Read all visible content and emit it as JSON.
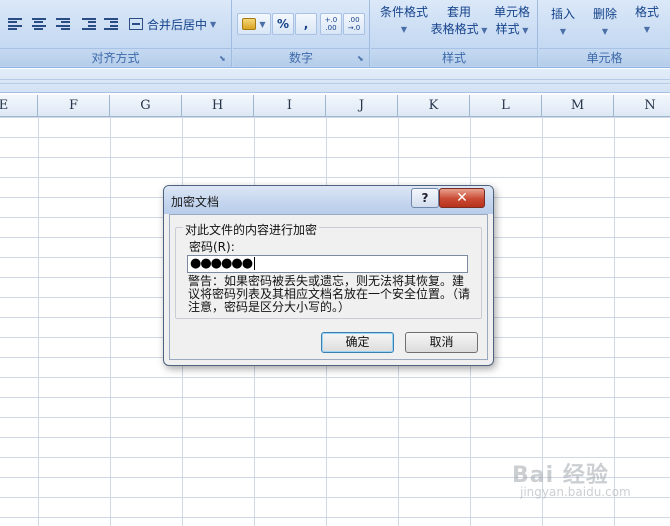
{
  "ribbon": {
    "alignment_group": {
      "merge_center_label": "合并后居中",
      "label": "对齐方式"
    },
    "number_group": {
      "percent_label": "%",
      "comma_label": ",",
      "increase_decimal_label": "+.0 .00",
      "decrease_decimal_label": ".00 →.0",
      "label": "数字"
    },
    "styles_group": {
      "conditional_format_label": "条件格式",
      "table_format_line1": "套用",
      "table_format_line2": "表格格式",
      "cell_style_line1": "单元格",
      "cell_style_line2": "样式",
      "label": "样式"
    },
    "cells_group": {
      "insert_label": "插入",
      "delete_label": "删除",
      "format_label": "格式",
      "label": "单元格"
    }
  },
  "columns": [
    "E",
    "F",
    "G",
    "H",
    "I",
    "J",
    "K",
    "L",
    "M",
    "N"
  ],
  "dialog": {
    "title": "加密文档",
    "help_label": "?",
    "close_label": "✕",
    "group_title": "对此文件的内容进行加密",
    "password_label": "密码(R):",
    "password_value": "●●●●●●",
    "warning_text": "警告：如果密码被丢失或遗忘，则无法将其恢复。建议将密码列表及其相应文档名放在一个安全位置。（请注意，密码是区分大小写的。）",
    "ok_label": "确定",
    "cancel_label": "取消"
  },
  "watermark": {
    "main": "Bai 经验",
    "sub": "jingyan.baidu.com"
  }
}
